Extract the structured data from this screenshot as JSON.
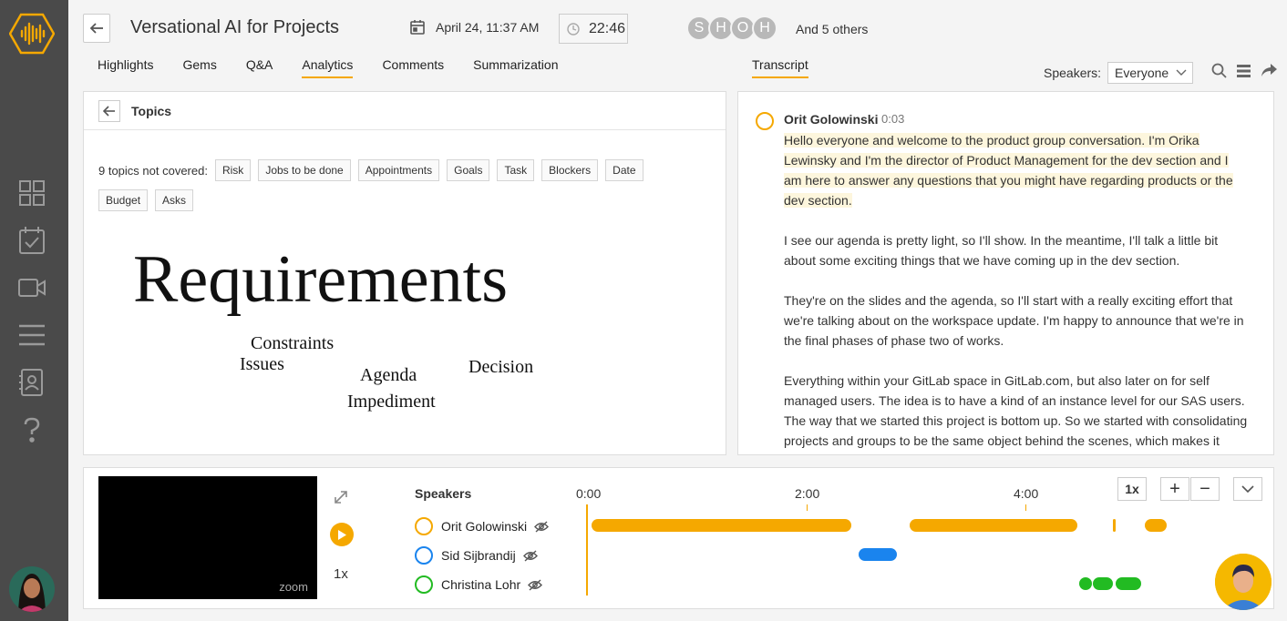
{
  "header": {
    "title": "Versational AI for Projects",
    "date": "April 24, 11:37 AM",
    "duration": "22:46",
    "participants": [
      "S",
      "H",
      "O",
      "H"
    ],
    "others": "And 5 others"
  },
  "tabs": [
    {
      "label": "Highlights"
    },
    {
      "label": "Gems"
    },
    {
      "label": "Q&A"
    },
    {
      "label": "Analytics"
    },
    {
      "label": "Comments"
    },
    {
      "label": "Summarization"
    }
  ],
  "transcript_tab": "Transcript",
  "speakers_filter": {
    "label": "Speakers:",
    "value": "Everyone"
  },
  "topics": {
    "title": "Topics",
    "uncovered_label": "9 topics not covered:",
    "chips": [
      "Risk",
      "Jobs to be done",
      "Appointments",
      "Goals",
      "Task",
      "Blockers",
      "Date",
      "Budget",
      "Asks"
    ],
    "cloud": [
      "Requirements",
      "Constraints",
      "Issues",
      "Agenda",
      "Decision",
      "Impediment"
    ]
  },
  "transcript": {
    "speaker": "Orit Golowinski",
    "time": "0:03",
    "paragraphs": [
      "Hello everyone and welcome to the product group conversation. I'm Orika Lewinsky and I'm the director of Product Management for the dev section and I am here to answer any questions that you might have regarding products or the dev section.",
      "I see our agenda is pretty light, so I'll show. In the meantime, I'll talk a little bit about some exciting things that we have coming up in the dev section.",
      "They're on the slides and the agenda, so I'll start with a really exciting effort that we're talking about on the workspace update. I'm happy to announce that we're in the final phases of phase two of works.",
      "Everything within your GitLab space in GitLab.com, but also later on for self managed users. The idea is to have a kind of an instance level for our SAS users. The way that we started this project is bottom up. So we started with consolidating projects and groups to be the same object behind the scenes, which makes it easier to maintain and to add new features across them."
    ]
  },
  "player": {
    "video_brand": "zoom",
    "speed": "1x",
    "speakers_heading": "Speakers",
    "speakers": [
      {
        "name": "Orit Golowinski",
        "color": "#f5a800"
      },
      {
        "name": "Sid Sijbrandij",
        "color": "#1a84ee"
      },
      {
        "name": "Christina Lohr",
        "color": "#22bb22"
      }
    ],
    "timeline_labels": [
      "0:00",
      "2:00",
      "4:00"
    ],
    "zoom_label": "1x",
    "zoom_in": "+",
    "zoom_out": "−"
  },
  "colors": {
    "accent": "#f5a800",
    "sidebar": "#4a4a4a"
  }
}
